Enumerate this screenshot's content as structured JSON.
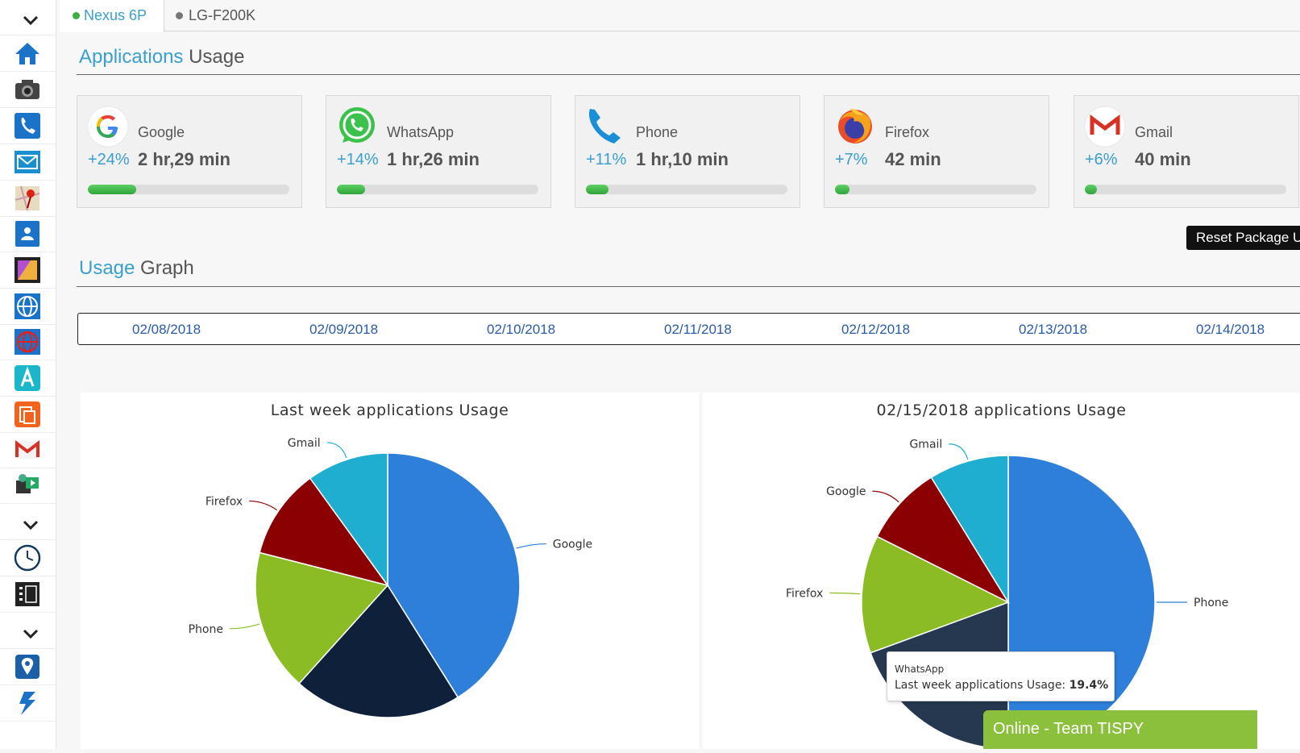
{
  "sidebar": {
    "items": [
      {
        "icon": "chevron-down-icon",
        "name": "sidebar-toggle"
      },
      {
        "icon": "home-icon",
        "name": "sidebar-item-home"
      },
      {
        "icon": "camera-icon",
        "name": "sidebar-item-camera"
      },
      {
        "icon": "phone-icon",
        "name": "sidebar-item-calls"
      },
      {
        "icon": "mail-icon",
        "name": "sidebar-item-messages"
      },
      {
        "icon": "map-pin-icon",
        "name": "sidebar-item-locations"
      },
      {
        "icon": "contact-icon",
        "name": "sidebar-item-contacts"
      },
      {
        "icon": "gallery-icon",
        "name": "sidebar-item-photos"
      },
      {
        "icon": "globe-icon",
        "name": "sidebar-item-browser"
      },
      {
        "icon": "globe-red-icon",
        "name": "sidebar-item-websites"
      },
      {
        "icon": "apps-icon",
        "name": "sidebar-item-applications"
      },
      {
        "icon": "notes-icon",
        "name": "sidebar-item-notes"
      },
      {
        "icon": "gmail-icon",
        "name": "sidebar-item-gmail"
      },
      {
        "icon": "media-icon",
        "name": "sidebar-item-media"
      },
      {
        "icon": "chevron-down-icon",
        "name": "sidebar-expand-more"
      },
      {
        "icon": "clock-icon",
        "name": "sidebar-item-schedule"
      },
      {
        "icon": "sim-icon",
        "name": "sidebar-item-sim"
      },
      {
        "icon": "chevron-down-icon",
        "name": "sidebar-expand-more-2"
      },
      {
        "icon": "location-icon",
        "name": "sidebar-item-geofence"
      },
      {
        "icon": "lightning-icon",
        "name": "sidebar-item-actions"
      }
    ]
  },
  "tabs": [
    {
      "label": "Nexus 6P",
      "status_color": "#3cb043"
    },
    {
      "label": "LG-F200K",
      "status_color": "#777777"
    }
  ],
  "usage_section": {
    "accent": "Applications",
    "rest": " Usage"
  },
  "apps": [
    {
      "name": "Google",
      "pct": "+24%",
      "duration": "2 hr,29 min",
      "fraction": 0.24,
      "icon": "google-icon"
    },
    {
      "name": "WhatsApp",
      "pct": "+14%",
      "duration": "1 hr,26 min",
      "fraction": 0.14,
      "icon": "whatsapp-icon"
    },
    {
      "name": "Phone",
      "pct": "+11%",
      "duration": "1 hr,10 min",
      "fraction": 0.11,
      "icon": "phone-icon"
    },
    {
      "name": "Firefox",
      "pct": "+7%",
      "duration": "42 min",
      "fraction": 0.07,
      "icon": "firefox-icon"
    },
    {
      "name": "Gmail",
      "pct": "+6%",
      "duration": "40 min",
      "fraction": 0.06,
      "icon": "gmail-icon"
    }
  ],
  "reset_button": "Reset Package U",
  "graph_section": {
    "accent": "Usage",
    "rest": " Graph"
  },
  "dates": [
    "02/08/2018",
    "02/09/2018",
    "02/10/2018",
    "02/11/2018",
    "02/12/2018",
    "02/13/2018",
    "02/14/2018"
  ],
  "chart_data": [
    {
      "type": "pie",
      "title": "Last week applications Usage",
      "slices": [
        {
          "label": "Google",
          "value": 38.7,
          "color": "#2e7fd9"
        },
        {
          "label": "WhatsApp",
          "value": 19.4,
          "color": "#0f213a",
          "labeled": false
        },
        {
          "label": "Phone",
          "value": 16.3,
          "color": "#8cbc24"
        },
        {
          "label": "Firefox",
          "value": 10.4,
          "color": "#8b0000"
        },
        {
          "label": "Gmail",
          "value": 9.4,
          "color": "#1fadd0"
        }
      ]
    },
    {
      "type": "pie",
      "title": "02/15/2018 applications Usage",
      "slices": [
        {
          "label": "Phone",
          "value": 50.0,
          "color": "#2e7fd9"
        },
        {
          "label": "WhatsApp",
          "value": 19.4,
          "color": "#26384f",
          "labeled": false
        },
        {
          "label": "Firefox",
          "value": 13.0,
          "color": "#8cbc24"
        },
        {
          "label": "Google",
          "value": 8.8,
          "color": "#8b0000"
        },
        {
          "label": "Gmail",
          "value": 8.8,
          "color": "#1fadd0"
        }
      ]
    }
  ],
  "tooltip": {
    "name": "WhatsApp",
    "series": "Last week applications Usage:",
    "value": "19.4%"
  },
  "chat": {
    "label": "Online - Team TISPY"
  }
}
